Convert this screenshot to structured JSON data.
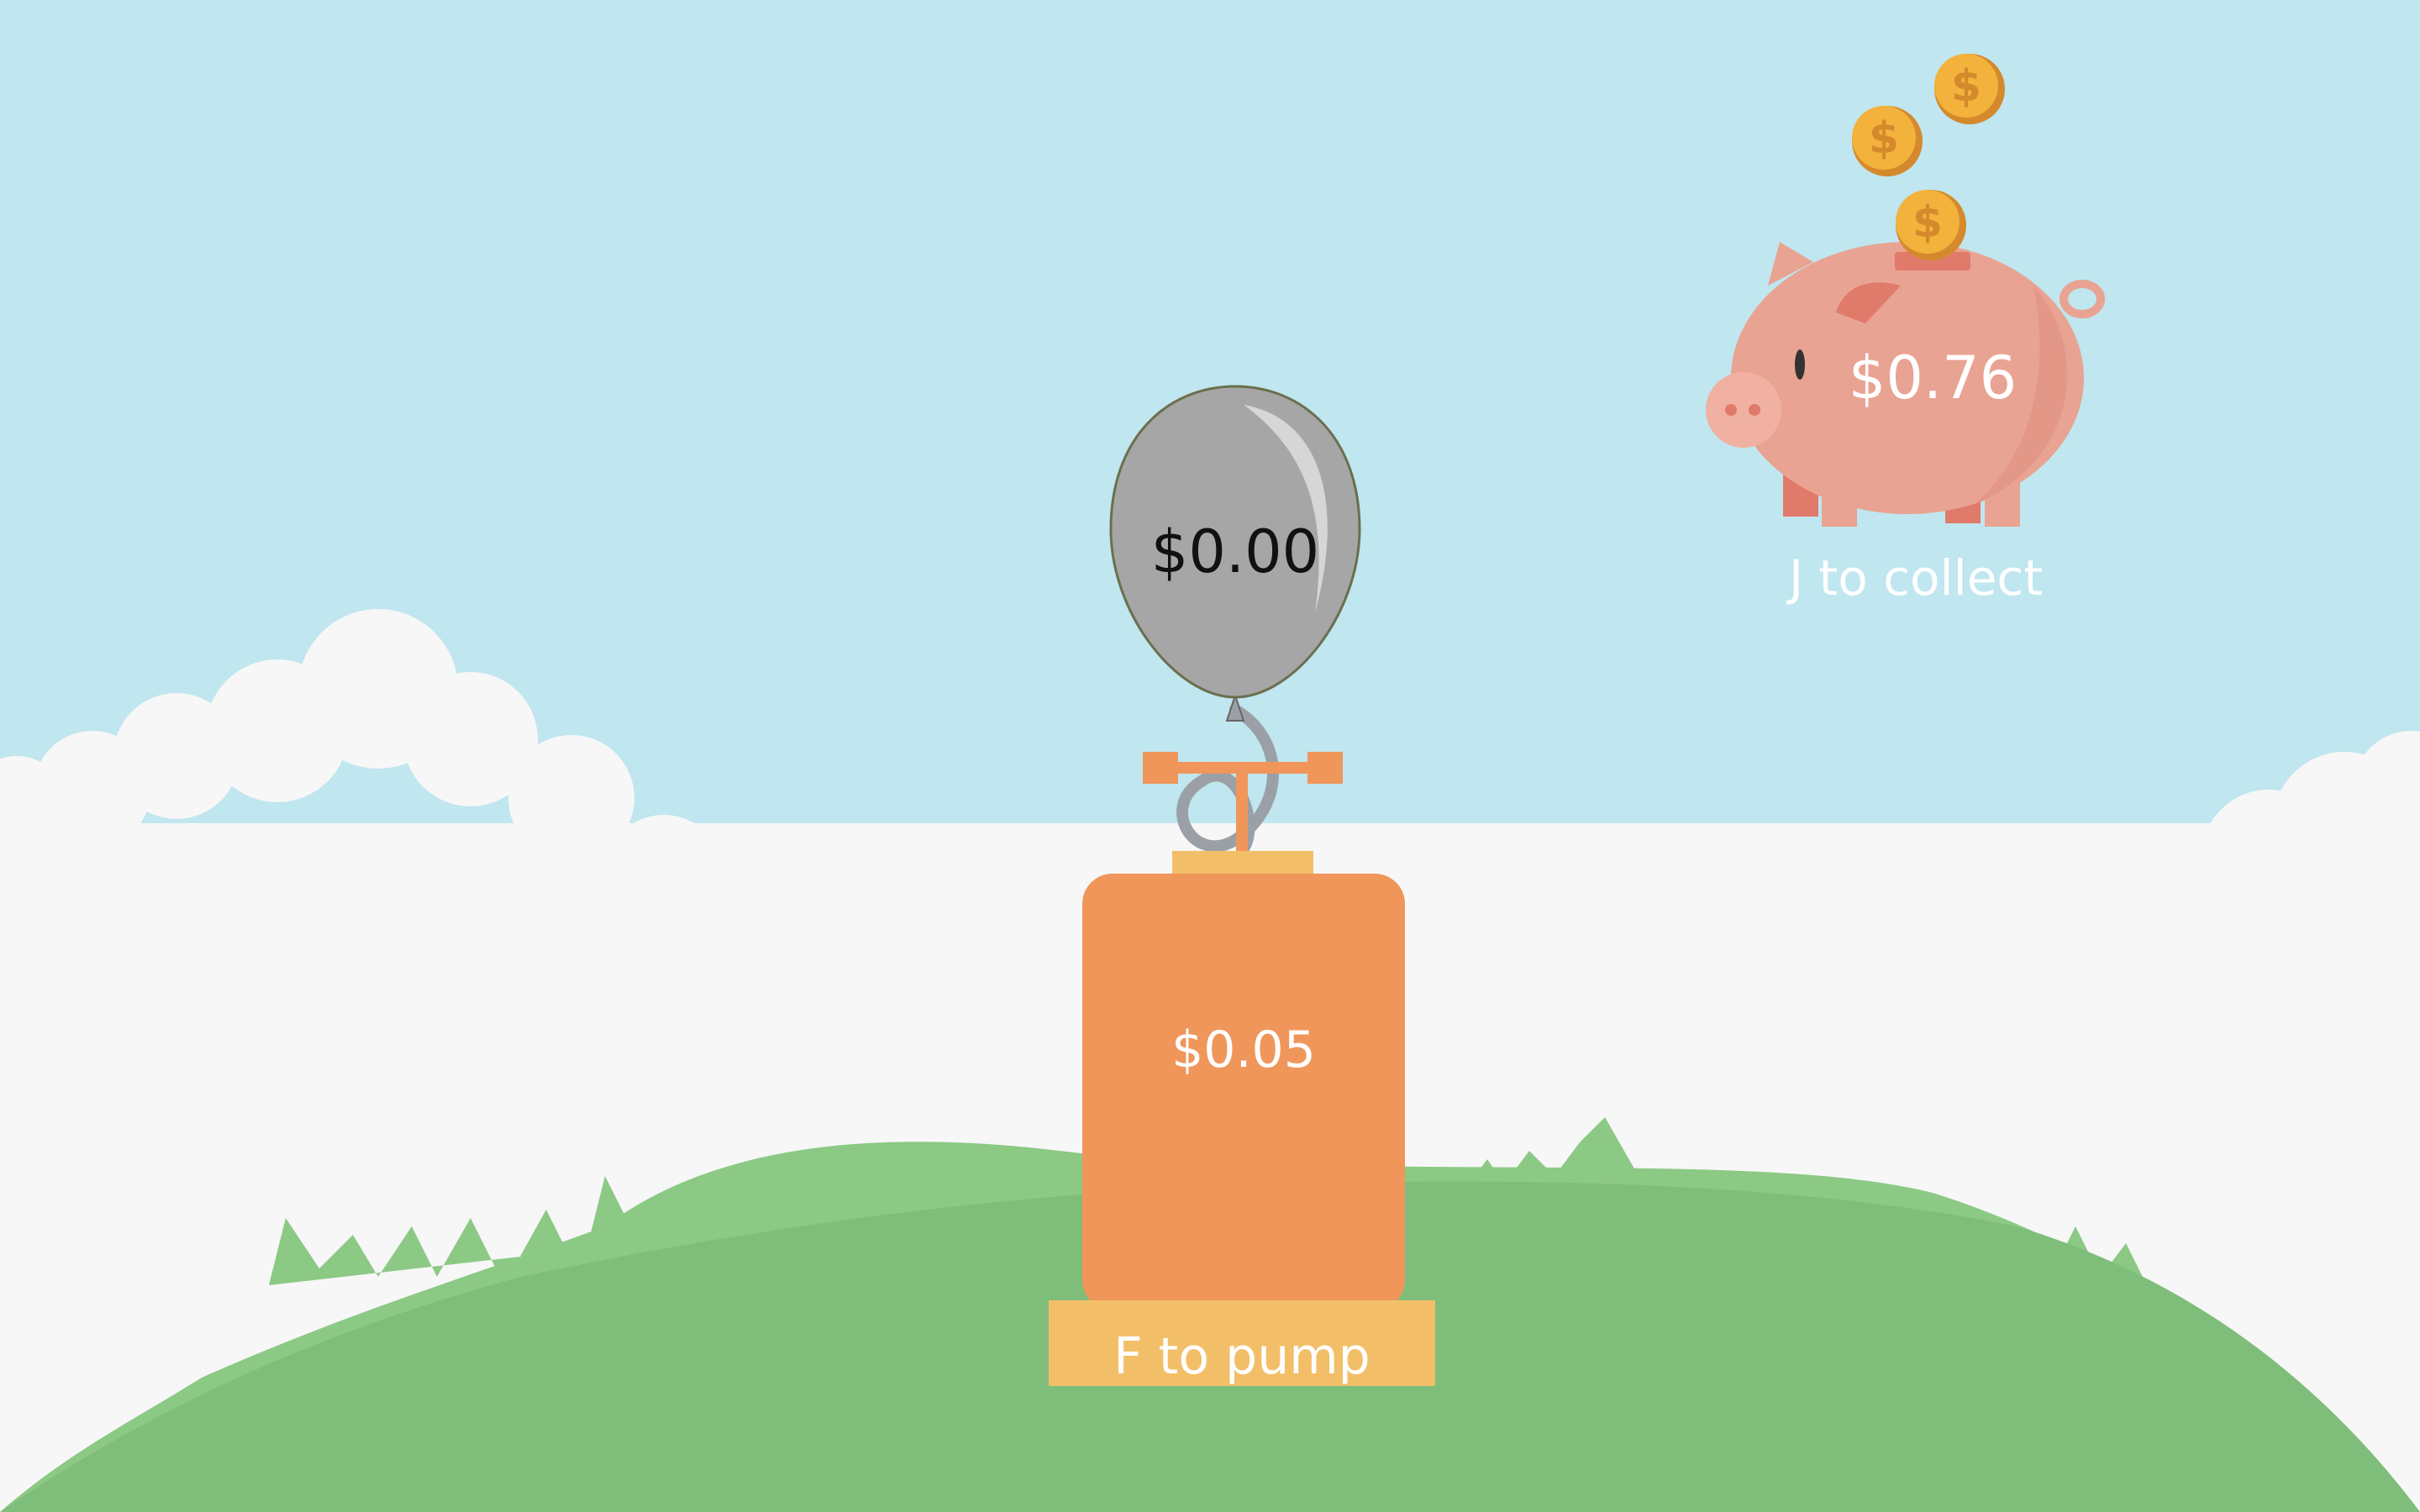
{
  "balloon": {
    "value": "$0.00",
    "color": "#a6a6a6"
  },
  "pump": {
    "value": "$0.05",
    "action_label": "F to pump",
    "color": "#f0965a",
    "base_color": "#f2bf68"
  },
  "piggy_bank": {
    "value": "$0.76",
    "action_label": "J to collect",
    "icon": "piggy-bank-icon",
    "color": "#e9a392"
  },
  "coins": {
    "icon": "dollar-coin-icon",
    "count": 3,
    "color": "#f2b23c"
  },
  "background": {
    "sky": "#c0e6ef",
    "clouds": "#f7f7f7",
    "hill": "#7fbd7a",
    "grass": "#8cc985"
  }
}
